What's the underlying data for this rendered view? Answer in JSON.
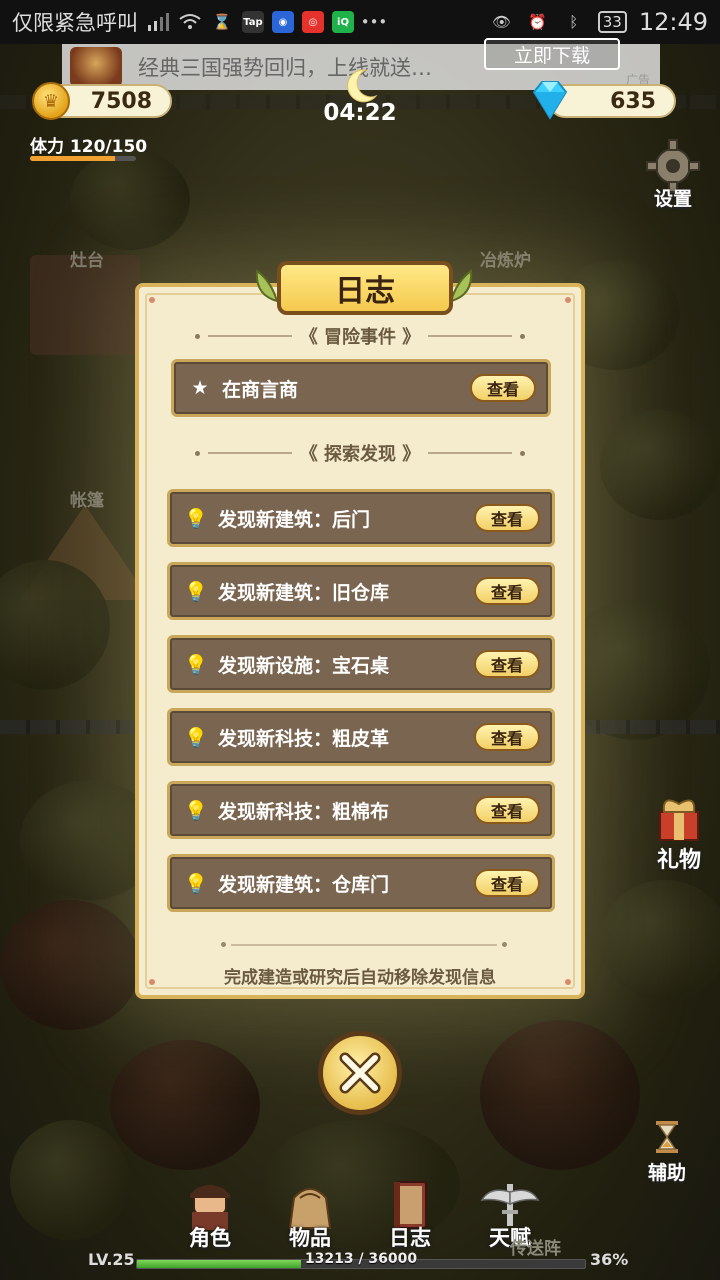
{
  "status_bar": {
    "notification_text": "仅限紧急呼叫",
    "battery": "33",
    "time": "12:49",
    "colors": {
      "background": "#111111"
    }
  },
  "ad_banner": {
    "text": "经典三国强势回归，上线就送…",
    "button": "立即下载",
    "tag": "广告"
  },
  "hud": {
    "coins": "7508",
    "gems": "635",
    "timer": "04:22",
    "stamina_label": "体力 120/150",
    "stamina_fraction": 0.8,
    "settings_label": "设置"
  },
  "scene_labels": {
    "stove": "灶台",
    "furnace": "冶炼炉",
    "tent": "帐篷",
    "teleport": "传送阵"
  },
  "dialog": {
    "title": "日志",
    "adventure_header": "冒险事件",
    "adventure_events": [
      {
        "icon": "star-icon",
        "label": "在商言商",
        "action": "查看"
      }
    ],
    "discovery_header": "探索发现",
    "discoveries": [
      {
        "icon": "lightbulb-icon",
        "label": "发现新建筑：后门",
        "action": "查看"
      },
      {
        "icon": "lightbulb-icon",
        "label": "发现新建筑：旧仓库",
        "action": "查看"
      },
      {
        "icon": "lightbulb-icon",
        "label": "发现新设施：宝石桌",
        "action": "查看"
      },
      {
        "icon": "lightbulb-icon",
        "label": "发现新科技：粗皮革",
        "action": "查看"
      },
      {
        "icon": "lightbulb-icon",
        "label": "发现新科技：粗棉布",
        "action": "查看"
      },
      {
        "icon": "lightbulb-icon",
        "label": "发现新建筑：仓库门",
        "action": "查看"
      }
    ],
    "footer_note": "完成建造或研究后自动移除发现信息",
    "colors": {
      "panel": "#f5ecce",
      "border": "#d9b35a",
      "row": "#7a6550",
      "button": "#f2d067"
    }
  },
  "side_buttons": {
    "gift": "礼物",
    "assist": "辅助"
  },
  "bottom_nav": {
    "items": [
      {
        "label": "角色",
        "icon": "character-icon"
      },
      {
        "label": "物品",
        "icon": "bag-icon"
      },
      {
        "label": "日志",
        "icon": "journal-icon"
      },
      {
        "label": "天赋",
        "icon": "talent-icon"
      }
    ]
  },
  "level": {
    "level": "LV.25",
    "xp_text": "13213 / 36000",
    "percent": "36%",
    "fraction": 0.367
  }
}
